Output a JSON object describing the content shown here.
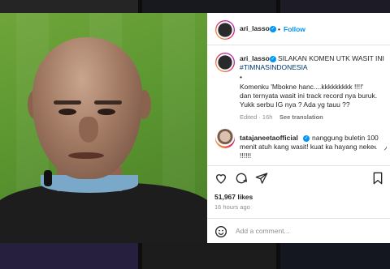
{
  "media": {
    "alt": "Referee close-up on green pitch"
  },
  "post_header": {
    "username": "ari_lasso",
    "separator": "•",
    "follow_label": "Follow"
  },
  "caption": {
    "username": "ari_lasso",
    "line1": "SILAKAN KOMEN UTK WASIT INI",
    "hashtag": "#TIMNASINDONESIA",
    "bullet": "•",
    "body1": "Komenku 'Mbokne hanc....kkkkkkkkk !!!!'",
    "body2": "dan ternyata wasit ini track record nya buruk.",
    "body3": "Yukk serbu IG nya ? Ada yg tauu ??",
    "edited": "Edited · 16h",
    "see_translation": "See translation"
  },
  "comment": {
    "username": "tatajaneetaofficial",
    "text1": "nanggung buletin 100",
    "text2": "menit atuh kang wasit! kuat ka hayang nekeee",
    "text3": "!!!!!!"
  },
  "actions": {
    "like_icon": "heart-icon",
    "comment_icon": "comment-icon",
    "share_icon": "share-icon",
    "save_icon": "save-icon"
  },
  "stats": {
    "likes": "51,967 likes",
    "time": "16 hours ago"
  },
  "add_comment": {
    "emoji_icon": "emoji-icon",
    "placeholder": "Add a comment..."
  },
  "colors": {
    "link": "#0095f6",
    "verified": "#0095f6",
    "hashtag": "#00376b",
    "muted": "#8e8e8e"
  }
}
